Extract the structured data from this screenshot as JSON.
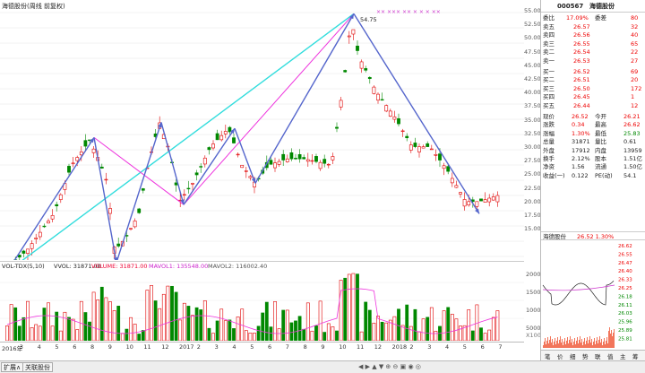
{
  "title": "海德股份(周线 前复权)",
  "price_axis": [
    "55.00",
    "52.50",
    "50.00",
    "47.50",
    "45.00",
    "42.50",
    "40.00",
    "37.50",
    "35.00",
    "32.50",
    "30.00",
    "27.50",
    "25.00",
    "22.50",
    "20.00",
    "17.50",
    "15.00"
  ],
  "annot_high": "54.75",
  "annot_low": "11.18",
  "vol_header": {
    "name": "VOL-TDX(5,10)",
    "vvol": "VVOL: 31871.00",
    "volume": "VOLUME: 31871.00",
    "mavol1": "MAVOL1: 135548.00",
    "mavol2": "MAVOL2: 116002.40"
  },
  "vol_axis": [
    "20000",
    "15000",
    "10000",
    "5000"
  ],
  "vol_unit": "X100",
  "dates": [
    "2016年",
    "3",
    "4",
    "5",
    "6",
    "8",
    "9",
    "10",
    "11",
    "12",
    "2017",
    "2",
    "3",
    "4",
    "5",
    "6",
    "7",
    "8",
    "9",
    "10",
    "11",
    "12",
    "2018",
    "2",
    "3",
    "4",
    "5",
    "6",
    "7"
  ],
  "bottom_tabs": [
    "扩展∧",
    "关联股份"
  ],
  "quote": {
    "code": "000567",
    "name": "海德股份"
  },
  "wei": {
    "wb_label": "委比",
    "wb": "17.09%",
    "wc_label": "委差",
    "wc": "80"
  },
  "sell": [
    {
      "l": "卖五",
      "p": "26.57",
      "v": "32"
    },
    {
      "l": "卖四",
      "p": "26.56",
      "v": "40"
    },
    {
      "l": "卖三",
      "p": "26.55",
      "v": "65"
    },
    {
      "l": "卖二",
      "p": "26.54",
      "v": "22"
    },
    {
      "l": "卖一",
      "p": "26.53",
      "v": "27"
    }
  ],
  "buy": [
    {
      "l": "买一",
      "p": "26.52",
      "v": "69"
    },
    {
      "l": "买二",
      "p": "26.51",
      "v": "20"
    },
    {
      "l": "买三",
      "p": "26.50",
      "v": "172"
    },
    {
      "l": "买四",
      "p": "26.45",
      "v": "1"
    },
    {
      "l": "买五",
      "p": "26.44",
      "v": "12"
    }
  ],
  "stats": [
    {
      "a": "现价",
      "b": "26.52",
      "c": "今开",
      "d": "26.21"
    },
    {
      "a": "涨跌",
      "b": "0.34",
      "c": "最高",
      "d": "26.62"
    },
    {
      "a": "涨幅",
      "b": "1.30%",
      "c": "最低",
      "d": "25.83"
    },
    {
      "a": "总量",
      "b": "31871",
      "c": "量比",
      "d": "0.61"
    },
    {
      "a": "外盘",
      "b": "17912",
      "c": "内盘",
      "d": "13959"
    },
    {
      "a": "换手",
      "b": "2.12%",
      "c": "股本",
      "d": "1.51亿"
    },
    {
      "a": "净资",
      "b": "1.56",
      "c": "流通",
      "d": "1.50亿"
    },
    {
      "a": "收益(一)",
      "b": "0.122",
      "c": "PE(动)",
      "d": "54.1"
    }
  ],
  "mini_title": {
    "name": "海德股份",
    "val": "26.52 1.30%"
  },
  "mini_axis": [
    "26.62",
    "26.55",
    "26.47",
    "26.40",
    "26.33",
    "26.25",
    "26.18",
    "26.11",
    "26.03",
    "25.96",
    "25.89",
    "25.81"
  ],
  "right_tabs": [
    "笔",
    "价",
    "细",
    "势",
    "联",
    "值",
    "主",
    "筹"
  ],
  "colors": {
    "up": "#e00000",
    "down": "#008800",
    "cyan": "#33dddd",
    "magenta": "#ee33dd",
    "blue": "#5566cc"
  }
}
